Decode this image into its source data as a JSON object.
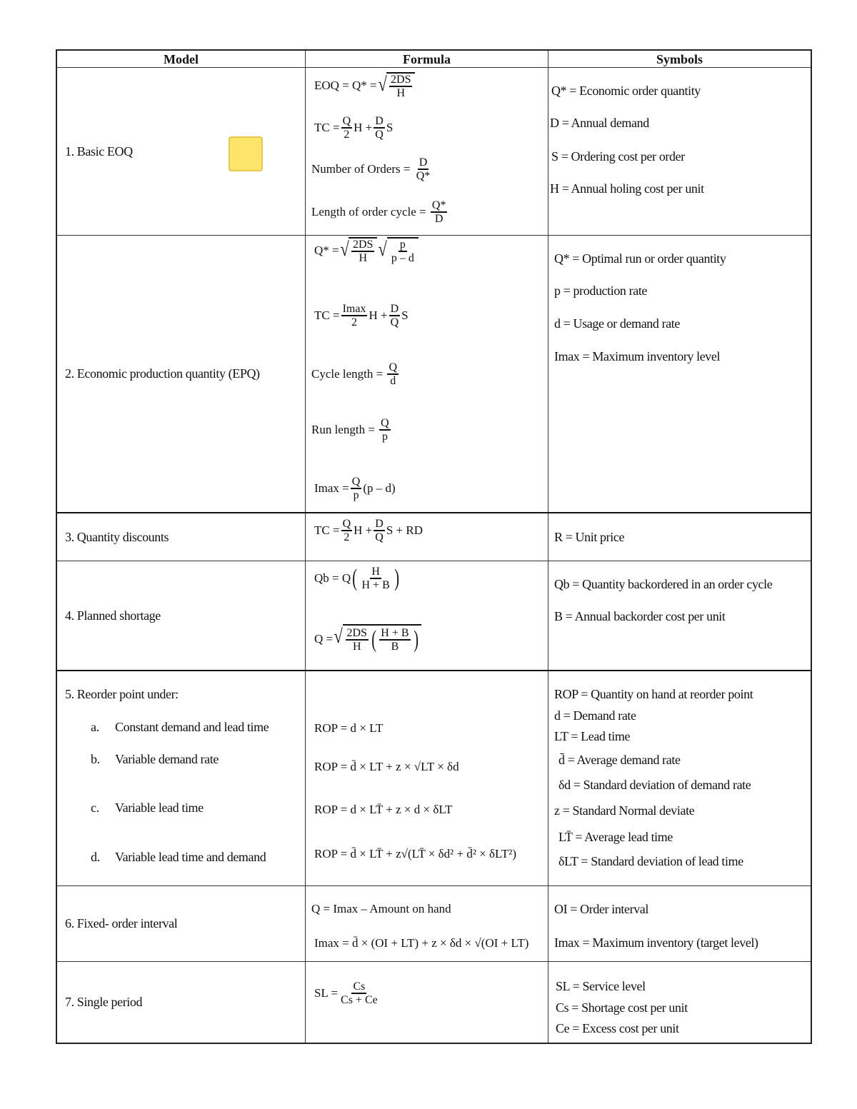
{
  "table": {
    "headers": [
      "Model",
      "Formula",
      "Symbols"
    ],
    "rows": [
      {
        "model": "1. Basic EOQ",
        "formulas": {
          "eoq_lhs": "EOQ = Q* =",
          "eoq_num": "2DS",
          "eoq_den": "H",
          "tc_lhs": "TC =",
          "tc_f1_num": "Q",
          "tc_f1_den": "2",
          "tc_mid": "H +",
          "tc_f2_num": "D",
          "tc_f2_den": "Q",
          "tc_end": "S",
          "orders_lhs": "Number of Orders =",
          "orders_num": "D",
          "orders_den": "Q*",
          "cycle_lhs": "Length of order cycle =",
          "cycle_num": "Q*",
          "cycle_den": "D"
        },
        "symbols": [
          "Q* = Economic order quantity",
          "D = Annual demand",
          "S = Ordering cost per order",
          "H = Annual holing cost per unit"
        ]
      },
      {
        "model": "2. Economic production quantity (EPQ)",
        "formulas": {
          "q_lhs": "Q* =",
          "q_r1_num": "2DS",
          "q_r1_den": "H",
          "q_r2_num": "p",
          "q_r2_den": "p – d",
          "tc_lhs": "TC =",
          "tc_f1_num": "Imax",
          "tc_f1_den": "2",
          "tc_mid": "H +",
          "tc_f2_num": "D",
          "tc_f2_den": "Q",
          "tc_end": "S",
          "cycle_lhs": "Cycle length =",
          "cycle_num": "Q",
          "cycle_den": "d",
          "run_lhs": "Run length =",
          "run_num": "Q",
          "run_den": "p",
          "imax_lhs": "Imax =",
          "imax_num": "Q",
          "imax_den": "p",
          "imax_end": "(p – d)"
        },
        "symbols": [
          "Q* = Optimal run or order quantity",
          "p = production rate",
          "d = Usage or demand rate",
          "Imax = Maximum inventory level"
        ]
      },
      {
        "model": "3. Quantity discounts",
        "formulas": {
          "tc_lhs": "TC =",
          "tc_f1_num": "Q",
          "tc_f1_den": "2",
          "tc_mid": "H +",
          "tc_f2_num": "D",
          "tc_f2_den": "Q",
          "tc_end": "S + RD"
        },
        "symbols": [
          "R = Unit price"
        ]
      },
      {
        "model": "4. Planned shortage",
        "formulas": {
          "qb_lhs": "Qb = Q",
          "qb_num": "H",
          "qb_den": "H + B",
          "q_lhs": "Q =",
          "q_f1_num": "2DS",
          "q_f1_den": "H",
          "q_f2_num": "H + B",
          "q_f2_den": "B"
        },
        "symbols": [
          "Qb = Quantity backordered in an order cycle",
          "B = Annual backorder cost per unit"
        ]
      },
      {
        "model": "5. Reorder point under:",
        "sub_items": [
          {
            "marker": "a.",
            "label": "Constant demand and lead time",
            "formula": "ROP = d × LT"
          },
          {
            "marker": "b.",
            "label": "Variable demand rate",
            "formula": "ROP = d̄ × LT + z × √LT × δd"
          },
          {
            "marker": "c.",
            "label": "Variable lead time",
            "formula": "ROP = d × LT̄ + z × d × δLT"
          },
          {
            "marker": "d.",
            "label": "Variable lead time and demand",
            "formula": "ROP = d̄ × LT̄ + z√(LT̄ × δd² + d̄² × δLT²)"
          }
        ],
        "symbols": [
          "ROP = Quantity on hand at reorder point",
          "d = Demand rate",
          "LT = Lead time",
          "d̄ = Average demand rate",
          "δd = Standard deviation of demand rate",
          "z = Standard Normal deviate",
          "LT̄ = Average lead time",
          "δLT = Standard deviation of lead time"
        ]
      },
      {
        "model": "6. Fixed- order interval",
        "formulas": {
          "q": "Q = Imax – Amount on hand",
          "imax": "Imax = d̄ × (OI + LT) + z × δd × √(OI + LT)"
        },
        "symbols": [
          "OI = Order interval",
          "Imax = Maximum inventory (target level)"
        ]
      },
      {
        "model": "7. Single period",
        "formulas": {
          "sl_lhs": "SL =",
          "sl_num": "Cs",
          "sl_den": "Cs + Ce"
        },
        "symbols": [
          "SL = Service level",
          "Cs = Shortage cost per unit",
          "Ce = Excess cost per unit"
        ]
      }
    ]
  },
  "sticky_note": {
    "color": "#fde46b",
    "border": "#e8c84a"
  }
}
